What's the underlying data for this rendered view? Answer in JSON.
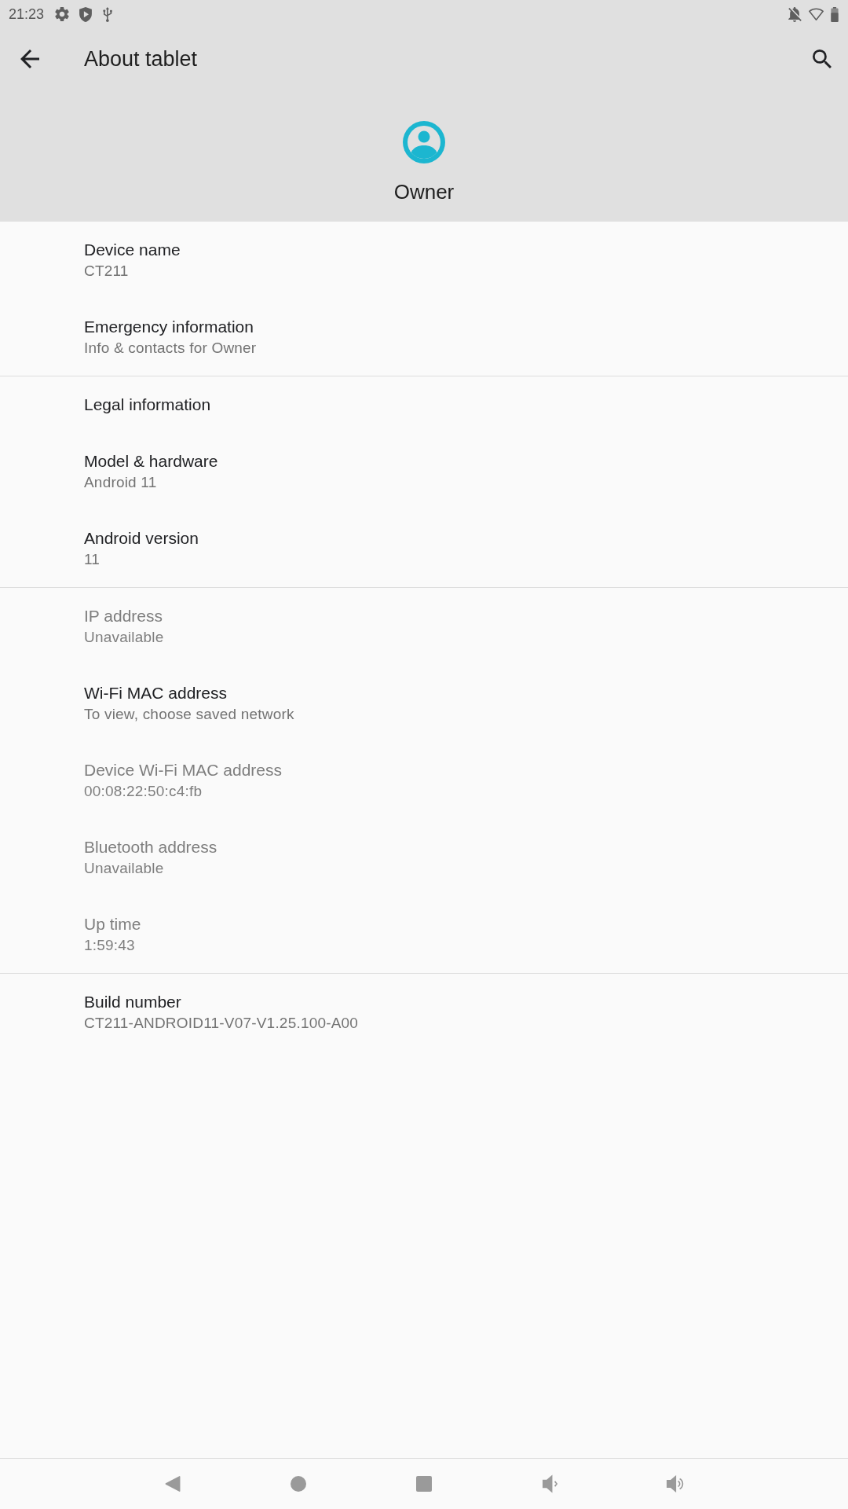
{
  "status_bar": {
    "time": "21:23"
  },
  "toolbar": {
    "title": "About tablet"
  },
  "profile": {
    "name": "Owner"
  },
  "sections": [
    {
      "items": [
        {
          "title": "Device name",
          "summary": "CT211",
          "disabled": false
        },
        {
          "title": "Emergency information",
          "summary": "Info & contacts for Owner",
          "disabled": false
        }
      ]
    },
    {
      "items": [
        {
          "title": "Legal information",
          "disabled": false
        },
        {
          "title": "Model & hardware",
          "summary": "Android 11",
          "disabled": false
        },
        {
          "title": "Android version",
          "summary": "11",
          "disabled": false
        }
      ]
    },
    {
      "items": [
        {
          "title": "IP address",
          "summary": "Unavailable",
          "disabled": true
        },
        {
          "title": "Wi-Fi MAC address",
          "summary": "To view, choose saved network",
          "disabled": false
        },
        {
          "title": "Device Wi-Fi MAC address",
          "summary": "00:08:22:50:c4:fb",
          "disabled": true
        },
        {
          "title": "Bluetooth address",
          "summary": "Unavailable",
          "disabled": true
        },
        {
          "title": "Up time",
          "summary": "1:59:43",
          "disabled": true
        }
      ]
    },
    {
      "items": [
        {
          "title": "Build number",
          "summary": "CT211-ANDROID11-V07-V1.25.100-A00",
          "disabled": false
        }
      ]
    }
  ]
}
